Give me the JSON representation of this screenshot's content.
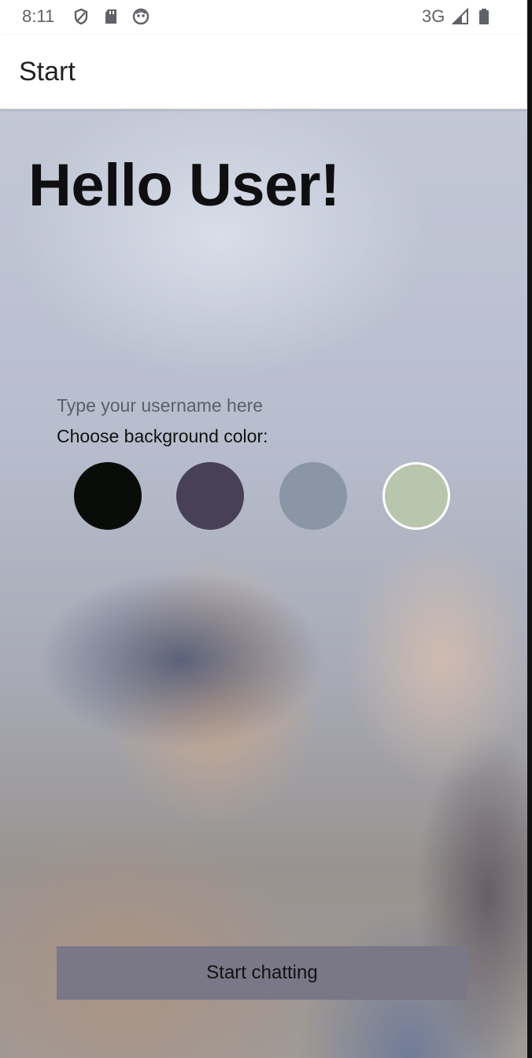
{
  "status_bar": {
    "time": "8:11",
    "network": "3G",
    "icons": [
      "shield-icon",
      "sd-card-icon",
      "assistant-icon",
      "signal-icon",
      "battery-icon"
    ]
  },
  "app_bar": {
    "title": "Start"
  },
  "main": {
    "greeting": "Hello User!",
    "username_placeholder": "Type your username here",
    "username_value": "",
    "color_label": "Choose background color:",
    "colors": [
      "#090C08",
      "#474056",
      "#8A95A5",
      "#B9C6AE"
    ],
    "selected_color_index": 3,
    "start_button_label": "Start chatting",
    "start_button_color": "#7A7787"
  }
}
